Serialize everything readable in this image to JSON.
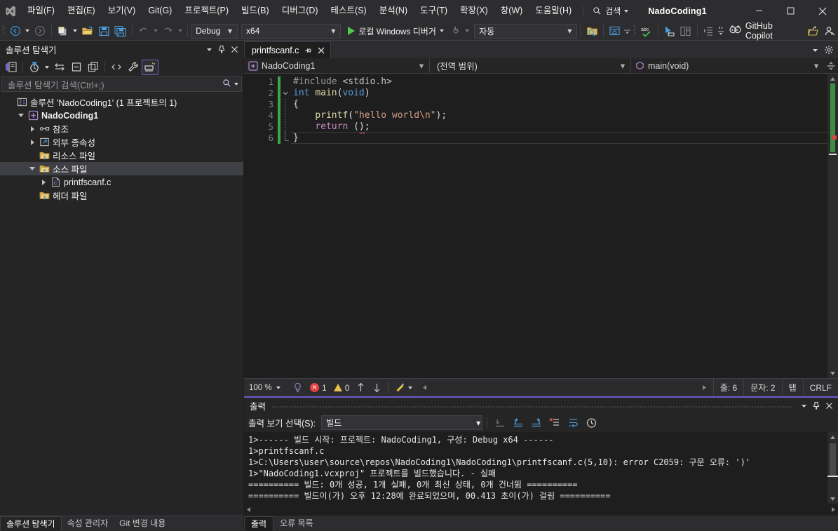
{
  "window": {
    "app_title": "NadoCoding1",
    "minimize": "─",
    "maximize": "□",
    "close": "✕"
  },
  "menu": {
    "items": [
      {
        "label": "파일(F)",
        "name": "menu-file"
      },
      {
        "label": "편집(E)",
        "name": "menu-edit"
      },
      {
        "label": "보기(V)",
        "name": "menu-view"
      },
      {
        "label": "Git(G)",
        "name": "menu-git"
      },
      {
        "label": "프로젝트(P)",
        "name": "menu-project"
      },
      {
        "label": "빌드(B)",
        "name": "menu-build"
      },
      {
        "label": "디버그(D)",
        "name": "menu-debug"
      },
      {
        "label": "테스트(S)",
        "name": "menu-test"
      },
      {
        "label": "분석(N)",
        "name": "menu-analyze"
      },
      {
        "label": "도구(T)",
        "name": "menu-tools"
      },
      {
        "label": "확장(X)",
        "name": "menu-extensions"
      },
      {
        "label": "창(W)",
        "name": "menu-window"
      },
      {
        "label": "도움말(H)",
        "name": "menu-help"
      }
    ],
    "search_label": "검색"
  },
  "toolbar": {
    "configuration": "Debug",
    "platform": "x64",
    "run_label": "로컬 Windows 디버거",
    "attach_target": "자동",
    "copilot_label": "GitHub Copilot"
  },
  "sidebar": {
    "title": "솔루션 탐색기",
    "search_placeholder": "솔루션 탐색기 검색(Ctrl+;)",
    "tree": [
      {
        "label": "솔루션 'NadoCoding1' (1 프로젝트의 1)",
        "name": "tree-solution",
        "indent": 0,
        "icon": "solution-icon",
        "twisty": "none",
        "bold": false,
        "selected": false
      },
      {
        "label": "NadoCoding1",
        "name": "tree-project",
        "indent": 1,
        "icon": "project-icon",
        "twisty": "open",
        "bold": true,
        "selected": false
      },
      {
        "label": "참조",
        "name": "tree-references",
        "indent": 2,
        "icon": "references-icon",
        "twisty": "closed",
        "bold": false,
        "selected": false
      },
      {
        "label": "외부 종속성",
        "name": "tree-external-dependencies",
        "indent": 2,
        "icon": "external-dep-icon",
        "twisty": "closed",
        "bold": false,
        "selected": false
      },
      {
        "label": "리소스 파일",
        "name": "tree-resource-files",
        "indent": 2,
        "icon": "filter-folder-icon",
        "twisty": "none",
        "bold": false,
        "selected": false
      },
      {
        "label": "소스 파일",
        "name": "tree-source-files",
        "indent": 2,
        "icon": "filter-folder-icon",
        "twisty": "open",
        "bold": false,
        "selected": true
      },
      {
        "label": "printfscanf.c",
        "name": "tree-file-printfscanf-c",
        "indent": 3,
        "icon": "c-file-icon",
        "twisty": "closed",
        "bold": false,
        "selected": false
      },
      {
        "label": "헤더 파일",
        "name": "tree-header-files",
        "indent": 2,
        "icon": "filter-folder-icon",
        "twisty": "none",
        "bold": false,
        "selected": false
      }
    ],
    "bottom_tabs": [
      {
        "label": "솔루션 탐색기",
        "name": "bottom-tab-solution-explorer",
        "active": true
      },
      {
        "label": "속성 관리자",
        "name": "bottom-tab-property-manager",
        "active": false
      },
      {
        "label": "Git 변경 내용",
        "name": "bottom-tab-git-changes",
        "active": false
      }
    ]
  },
  "editor": {
    "tab_label": "printfscanf.c",
    "nav_project": "NadoCoding1",
    "nav_scope": "(전역 범위)",
    "nav_member": "main(void)",
    "lines": [
      {
        "n": "1",
        "segs": [
          {
            "t": "#include ",
            "c": "k-pre"
          },
          {
            "t": "<stdio.h>",
            "c": "k-hdr"
          }
        ]
      },
      {
        "n": "2",
        "segs": [
          {
            "t": "int",
            "c": "k-kw"
          },
          {
            "t": " ",
            "c": "k-pun"
          },
          {
            "t": "main",
            "c": "k-fn"
          },
          {
            "t": "(",
            "c": "k-pun"
          },
          {
            "t": "void",
            "c": "k-kw"
          },
          {
            "t": ")",
            "c": "k-pun"
          }
        ]
      },
      {
        "n": "3",
        "segs": [
          {
            "t": "{",
            "c": "k-pun"
          }
        ]
      },
      {
        "n": "4",
        "segs": [
          {
            "t": "    ",
            "c": "k-pun"
          },
          {
            "t": "printf",
            "c": "k-fn"
          },
          {
            "t": "(",
            "c": "k-pun"
          },
          {
            "t": "\"hello world\\n\"",
            "c": "k-str"
          },
          {
            "t": ");",
            "c": "k-pun"
          }
        ]
      },
      {
        "n": "5",
        "segs": [
          {
            "t": "    ",
            "c": "k-pun"
          },
          {
            "t": "return",
            "c": "k-ret"
          },
          {
            "t": " (",
            "c": "k-pun"
          },
          {
            "t": ")",
            "c": "k-err"
          },
          {
            "t": ";",
            "c": "k-pun"
          }
        ]
      },
      {
        "n": "6",
        "segs": [
          {
            "t": "}",
            "c": "k-pun"
          }
        ]
      }
    ],
    "status": {
      "zoom": "100 %",
      "error_count": "1",
      "warning_count": "0",
      "line_label": "줄: 6",
      "col_label": "문자: 2",
      "tab_label": "탭",
      "eol_label": "CRLF"
    }
  },
  "output": {
    "title": "출력",
    "selector_label": "출력 보기 선택(S):",
    "selector_value": "빌드",
    "lines": [
      "1>------ 빌드 시작: 프로젝트: NadoCoding1, 구성: Debug x64 ------",
      "1>printfscanf.c",
      "1>C:\\Users\\user\\source\\repos\\NadoCoding1\\NadoCoding1\\printfscanf.c(5,10): error C2059: 구문 오류: ')'",
      "1>\"NadoCoding1.vcxproj\" 프로젝트를 빌드했습니다. - 실패",
      "========== 빌드: 0개 성공, 1개 실패, 0개 최신 상태, 0개 건너뜀 ==========",
      "========== 빌드이(가) 오후 12:28에 완료되었으며, 00.413 초이(가) 걸림 =========="
    ],
    "tabs": [
      {
        "label": "출력",
        "name": "output-tab-output",
        "active": true
      },
      {
        "label": "오류 목록",
        "name": "output-tab-error-list",
        "active": false
      }
    ]
  },
  "colors": {
    "accent_purple": "#6a5acd",
    "changebar_green": "#3ea54a",
    "error_red": "#e04343",
    "warning_yellow": "#e8c14a",
    "run_green": "#4ec94e"
  }
}
